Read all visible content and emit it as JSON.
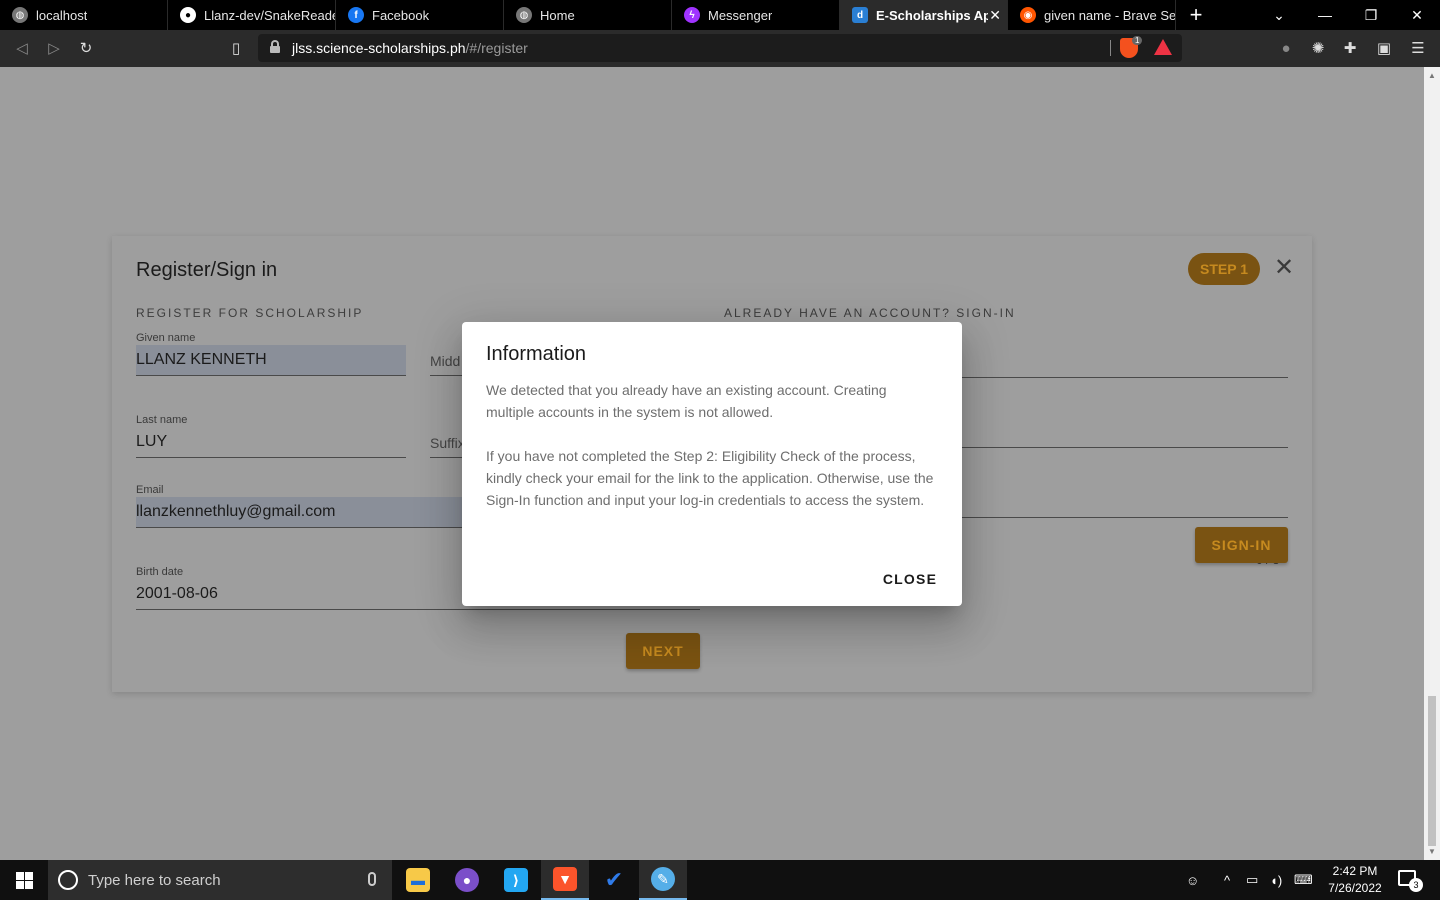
{
  "browser": {
    "tabs": [
      {
        "title": "localhost",
        "icon": "globe-icon",
        "color": "#cccccc"
      },
      {
        "title": "Llanz-dev/SnakeReader",
        "icon": "github-icon",
        "color": "#ffffff"
      },
      {
        "title": "Facebook",
        "icon": "facebook-icon",
        "color": "#1877f2"
      },
      {
        "title": "Home",
        "icon": "globe-icon",
        "color": "#cccccc"
      },
      {
        "title": "Messenger",
        "icon": "messenger-icon",
        "color": "#a033ff"
      },
      {
        "title": "E-Scholarships Appli",
        "icon": "dost-icon",
        "color": "#2a7fd4",
        "active": true
      },
      {
        "title": "given name - Brave Sear",
        "icon": "brave-search-icon",
        "color": "#ff5500"
      }
    ],
    "url_host": "jlss.science-scholarships.ph",
    "url_path": "/#/register",
    "brave_shield_count": "1"
  },
  "card": {
    "title": "Register/Sign in",
    "step_badge": "STEP 1",
    "register_heading": "REGISTER FOR SCHOLARSHIP",
    "signin_heading": "ALREADY HAVE AN ACCOUNT? SIGN-IN",
    "given_name_label": "Given name",
    "given_name_value": "LLANZ KENNETH",
    "middle_placeholder": "Midd",
    "last_name_label": "Last name",
    "last_name_value": "LUY",
    "suffix_placeholder": "Suffix",
    "email_label": "Email",
    "email_value": "llanzkennethluy@gmail.com",
    "birth_label": "Birth date",
    "birth_value": "2001-08-06",
    "counter": "0 / 8",
    "next_label": "NEXT",
    "signin_label": "SIGN-IN"
  },
  "dialog": {
    "title": "Information",
    "paragraph1": "We detected that you already have an existing account. Creating multiple accounts in the system is not allowed.",
    "paragraph2": "If you have not completed the Step 2: Eligibility Check of the process, kindly check your email for the link to the application. Otherwise, use the Sign-In function and input your log-in credentials to access the system.",
    "close_label": "CLOSE"
  },
  "taskbar": {
    "search_placeholder": "Type here to search",
    "time": "2:42 PM",
    "date": "7/26/2022",
    "notification_count": "3",
    "apps": [
      {
        "name": "file-explorer-icon",
        "color": "#f7c948"
      },
      {
        "name": "github-desktop-icon",
        "color": "#7b4fc9"
      },
      {
        "name": "vscode-icon",
        "color": "#23a7f2"
      },
      {
        "name": "brave-browser-icon",
        "color": "#fb542b",
        "active": true
      },
      {
        "name": "todo-icon",
        "color": "#2f7be9"
      },
      {
        "name": "paint-icon",
        "color": "#55aee8",
        "active": true
      }
    ]
  }
}
